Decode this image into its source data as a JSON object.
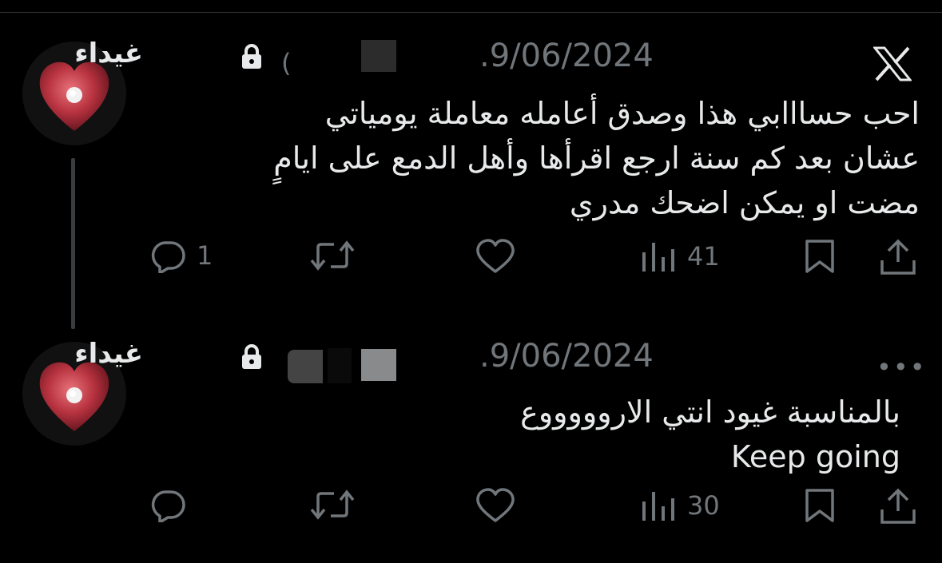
{
  "tweets": [
    {
      "author_name": "غيداء",
      "date": ".9/06/2024",
      "text_lines": [
        "احب حسااابي هذا وصدق أعامله معاملة يومياتي",
        "عشان بعد كم سنة ارجع اقرأها وأهل الدمع على ايامٍ",
        "مضت او يمكن اضحك مدري"
      ],
      "reply_count": "1",
      "view_count": "41"
    },
    {
      "author_name": "غيداء",
      "date": ".9/06/2024",
      "text_lines": [
        "بالمناسبة غيود انتي الاروووووع",
        "Keep going"
      ],
      "reply_count": "",
      "view_count": "30"
    }
  ],
  "icons": {
    "brand": "x-logo-icon",
    "more": "more-icon",
    "lock": "lock-icon",
    "avatar": "heart-avatar",
    "reply": "reply-icon",
    "retweet": "retweet-icon",
    "like": "like-icon",
    "views": "views-icon",
    "bookmark": "bookmark-icon",
    "share": "share-icon"
  },
  "colors": {
    "background": "#000000",
    "text": "#e7e9ea",
    "muted": "#71767b",
    "heart": "#c0303a"
  }
}
